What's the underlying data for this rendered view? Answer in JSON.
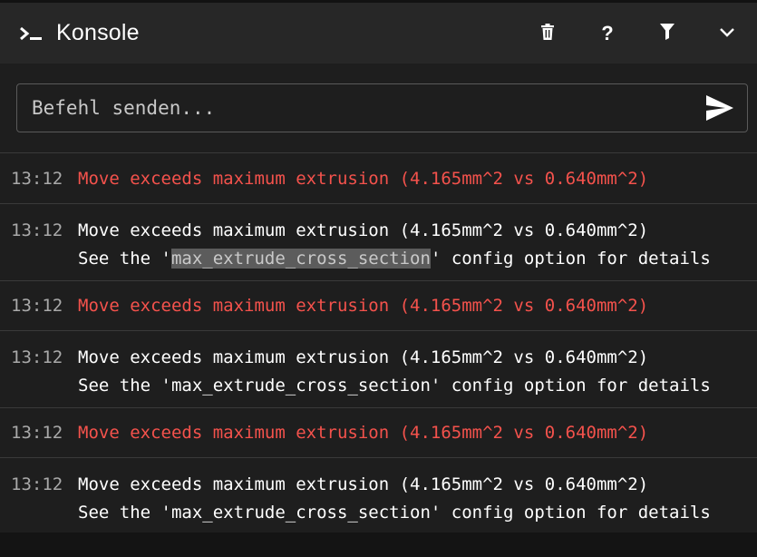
{
  "header": {
    "title": "Konsole",
    "icons": [
      "terminal-icon",
      "trash-icon",
      "help-icon",
      "filter-icon",
      "chevron-down-icon"
    ],
    "help_label": "?"
  },
  "command": {
    "placeholder": "Befehl senden...",
    "value": ""
  },
  "log": [
    {
      "time": "13:12",
      "type": "error",
      "line1": "Move exceeds maximum extrusion (4.165mm^2 vs 0.640mm^2)"
    },
    {
      "time": "13:12",
      "type": "normal",
      "line1": "Move exceeds maximum extrusion (4.165mm^2 vs 0.640mm^2)",
      "line2_pre": "See the '",
      "line2_hl": "max_extrude_cross_section",
      "line2_post": "' config option for details"
    },
    {
      "time": "13:12",
      "type": "error",
      "line1": "Move exceeds maximum extrusion (4.165mm^2 vs 0.640mm^2)"
    },
    {
      "time": "13:12",
      "type": "normal",
      "line1": "Move exceeds maximum extrusion (4.165mm^2 vs 0.640mm^2)",
      "line2": "See the 'max_extrude_cross_section' config option for details"
    },
    {
      "time": "13:12",
      "type": "error",
      "line1": "Move exceeds maximum extrusion (4.165mm^2 vs 0.640mm^2)"
    },
    {
      "time": "13:12",
      "type": "normal",
      "line1": "Move exceeds maximum extrusion (4.165mm^2 vs 0.640mm^2)",
      "line2": "See the 'max_extrude_cross_section' config option for details"
    }
  ],
  "colors": {
    "background": "#1e1e1e",
    "header": "#272727",
    "error_text": "#f4524c",
    "timestamp": "#a9a9a9",
    "highlight": "#5c5c5c"
  }
}
